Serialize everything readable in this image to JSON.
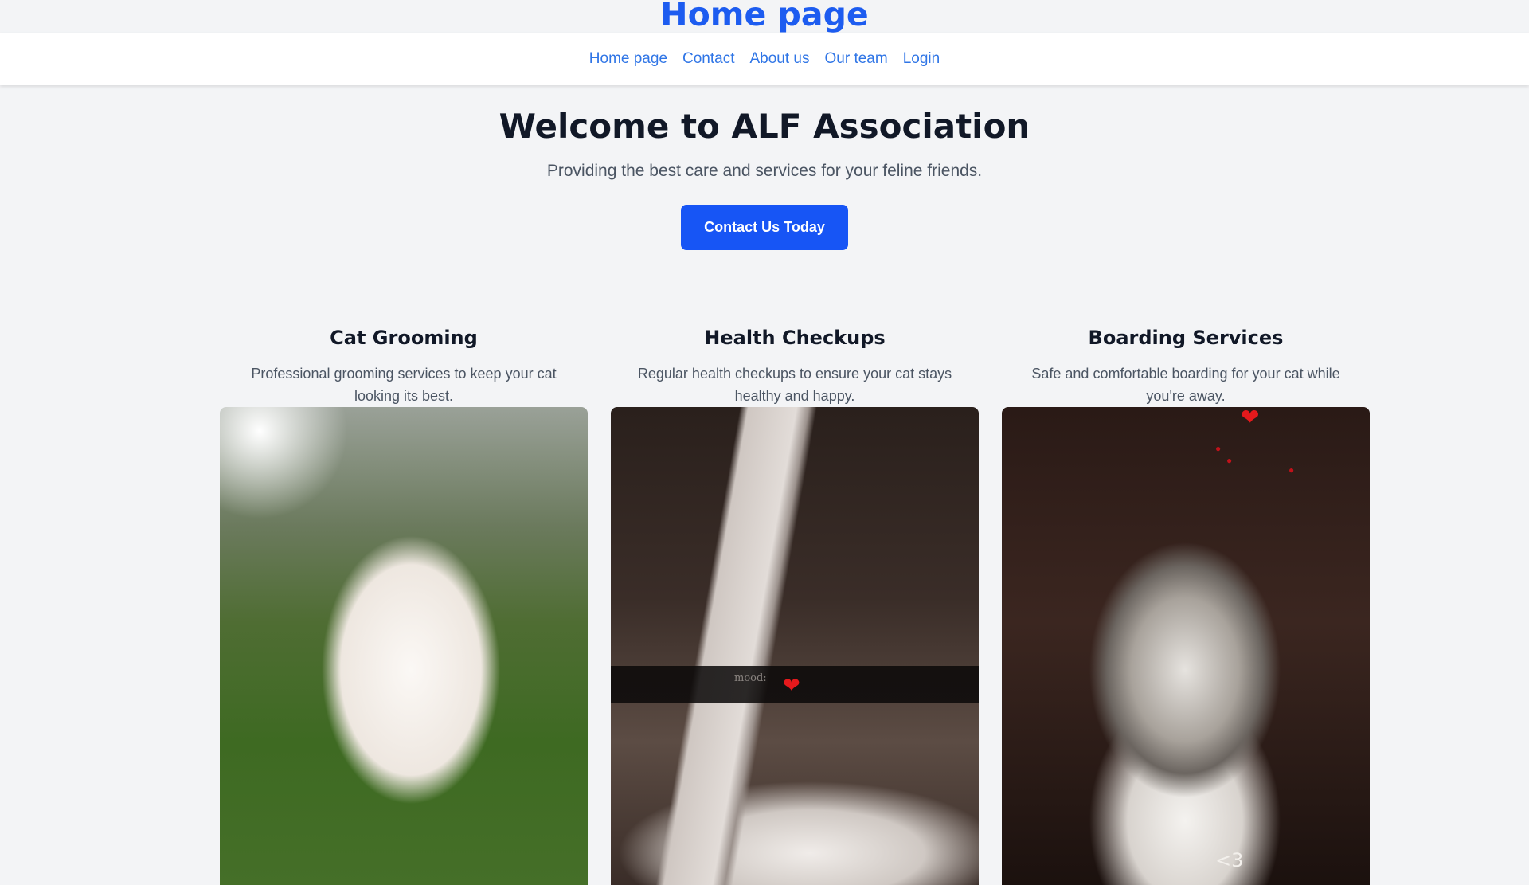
{
  "header": {
    "site_title": "Home page"
  },
  "nav": {
    "items": [
      {
        "label": "Home page"
      },
      {
        "label": "Contact"
      },
      {
        "label": "About us"
      },
      {
        "label": "Our team"
      },
      {
        "label": "Login"
      }
    ]
  },
  "hero": {
    "title": "Welcome to ALF Association",
    "subtitle": "Providing the best care and services for your feline friends.",
    "cta_label": "Contact Us Today"
  },
  "services": [
    {
      "title": "Cat Grooming",
      "description": "Professional grooming services to keep your cat looking its best.",
      "image_alt": "white and orange cat sitting in grass"
    },
    {
      "title": "Health Checkups",
      "description": "Regular health checkups to ensure your cat stays healthy and happy.",
      "image_alt": "cat sleeping in a blanket",
      "overlay_caption": "mood:",
      "overlay_emoji": "❤️"
    },
    {
      "title": "Boarding Services",
      "description": "Safe and comfortable boarding for your cat while you're away.",
      "image_alt": "tabby and white cat looking up",
      "overlay_tag": "<3"
    }
  ],
  "colors": {
    "brand_blue": "#1d5cf0",
    "nav_link": "#2f75e6",
    "cta_bg": "#1755f5",
    "page_bg": "#f3f4f6"
  }
}
